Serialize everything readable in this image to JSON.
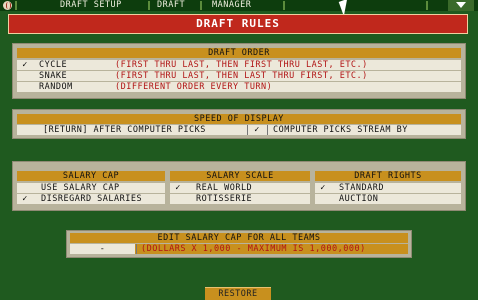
{
  "menu": {
    "items": [
      "DRAFT SETUP",
      "DRAFT",
      "MANAGER"
    ]
  },
  "icons": {
    "app": "baseball-icon",
    "dropdown": "down-arrow-icon",
    "pointer": "mouse-cursor-icon"
  },
  "title": "DRAFT RULES",
  "draft_order": {
    "header": "DRAFT ORDER",
    "options": [
      {
        "label": "CYCLE",
        "desc": "(FIRST THRU LAST, THEN FIRST THRU LAST, ETC.)",
        "checked": true
      },
      {
        "label": "SNAKE",
        "desc": "(FIRST THRU LAST, THEN LAST THRU FIRST, ETC.)",
        "checked": false
      },
      {
        "label": "RANDOM",
        "desc": "(DIFFERENT ORDER EVERY TURN)",
        "checked": false
      }
    ]
  },
  "speed": {
    "header": "SPEED OF DISPLAY",
    "option1": {
      "label": "[RETURN] AFTER COMPUTER PICKS",
      "checked": false
    },
    "option2": {
      "label": "COMPUTER PICKS STREAM BY",
      "checked": true
    }
  },
  "salary_cap": {
    "header": "SALARY CAP",
    "options": [
      {
        "label": "USE SALARY CAP",
        "checked": false
      },
      {
        "label": "DISREGARD SALARIES",
        "checked": true
      }
    ]
  },
  "salary_scale": {
    "header": "SALARY SCALE",
    "options": [
      {
        "label": "REAL WORLD",
        "checked": true
      },
      {
        "label": "ROTISSERIE",
        "checked": false
      }
    ]
  },
  "draft_rights": {
    "header": "DRAFT RIGHTS",
    "options": [
      {
        "label": "STANDARD",
        "checked": true
      },
      {
        "label": "AUCTION",
        "checked": false
      }
    ]
  },
  "salary_edit": {
    "header": "EDIT SALARY CAP FOR ALL TEAMS",
    "value": "-",
    "desc": "(DOLLARS X 1,000 - MAXIMUM IS 1,000,000)"
  },
  "check_mark": "✓",
  "restore_label": "RESTORE",
  "colors": {
    "background": "#1f5a1f",
    "title_bar": "#c0281c",
    "header": "#c8901e",
    "description_text": "#b01414"
  }
}
